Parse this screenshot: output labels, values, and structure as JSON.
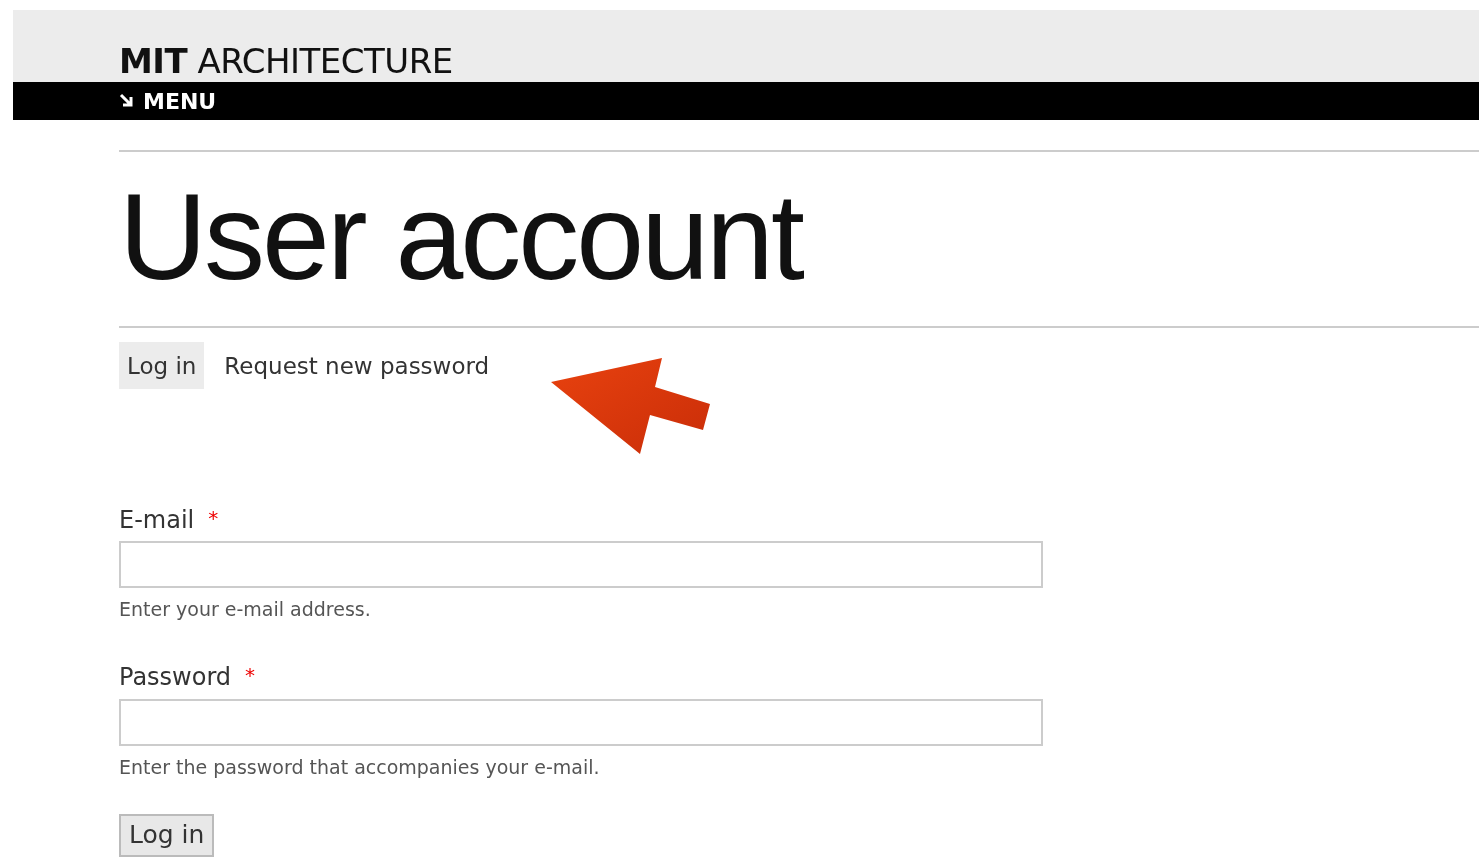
{
  "header": {
    "logo": "**MIT** ARCHITECTURE",
    "menu": "MENU"
  },
  "title": "User account",
  "tabs": [
    {
      "label": "Log in",
      "selected": true
    },
    {
      "label": "Request new password",
      "selected": false
    }
  ],
  "annotation": {
    "kind": "arrow"
  },
  "fields": [
    {
      "label": "E-mail",
      "marker": "*",
      "description": "Enter your e-mail address."
    },
    {
      "label": "Password",
      "marker": "*",
      "description": "Enter the password that accompanies your e-mail."
    }
  ],
  "submit": "Log in"
}
